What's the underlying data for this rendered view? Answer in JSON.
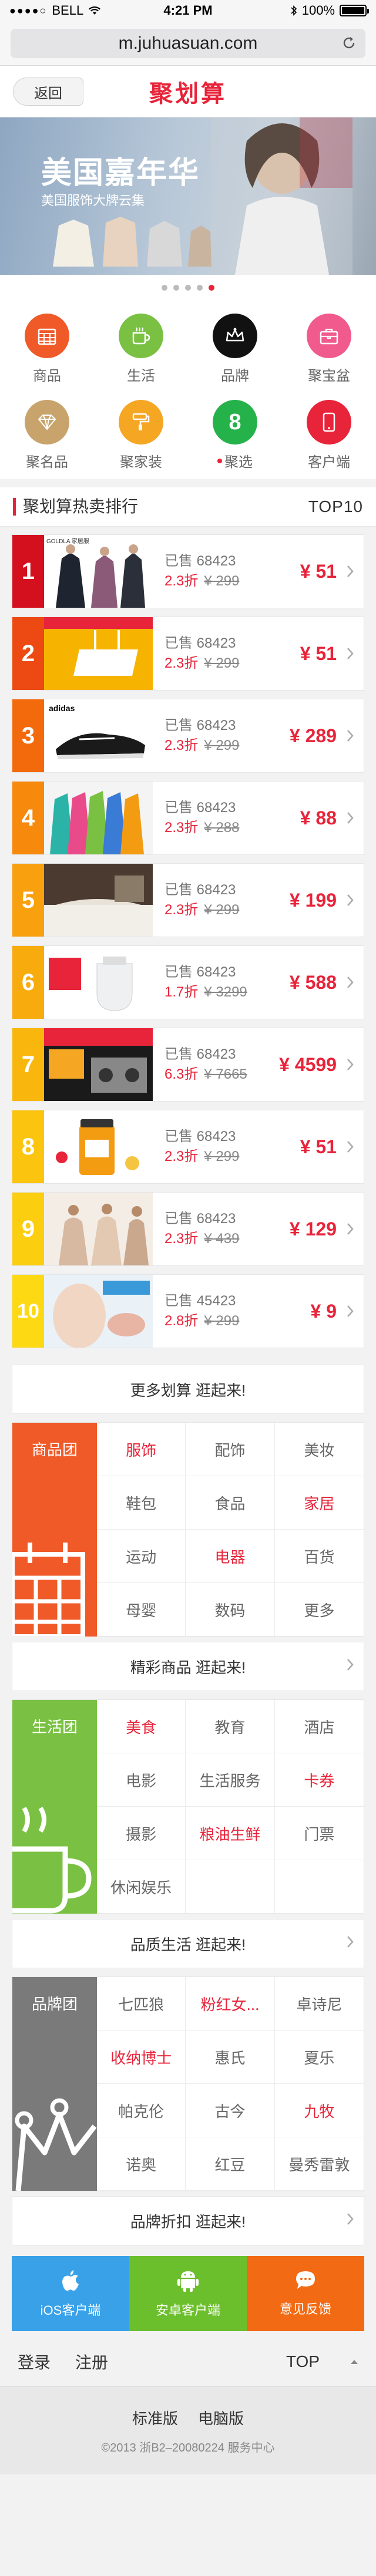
{
  "status_bar": {
    "carrier": "BELL",
    "time": "4:21 PM",
    "battery": "100%"
  },
  "address_bar": {
    "url": "m.juhuasuan.com"
  },
  "header": {
    "back_label": "返回",
    "title": "聚划算"
  },
  "banner": {
    "title": "美国嘉年华",
    "subtitle": "美国服饰大牌云集",
    "dots": 5,
    "active_dot": 5
  },
  "icon_grid": [
    {
      "label": "商品",
      "icon": "calendar-grid-icon",
      "color": "#f05a28"
    },
    {
      "label": "生活",
      "icon": "coffee-cup-icon",
      "color": "#7ac143"
    },
    {
      "label": "品牌",
      "icon": "crown-icon",
      "color": "#111111"
    },
    {
      "label": "聚宝盆",
      "icon": "briefcase-icon",
      "color": "#f05a8c"
    },
    {
      "label": "聚名品",
      "icon": "diamond-icon",
      "color": "#c8a46c"
    },
    {
      "label": "聚家装",
      "icon": "paint-roller-icon",
      "color": "#f5a623"
    },
    {
      "label": "聚选",
      "icon": "number-eight-icon",
      "color": "#26b24b",
      "glyph": "8"
    },
    {
      "label": "客户端",
      "icon": "phone-icon",
      "color": "#e8243a"
    }
  ],
  "ranking": {
    "title": "聚划算热卖排行",
    "right_label": "TOP10",
    "items": [
      {
        "rank": "1",
        "sold": "已售 68423",
        "discount": "2.3折",
        "original": "¥ 299",
        "price": "¥ 51",
        "color": "#d40f1e",
        "thumb_text": "GOLDLA 家居服"
      },
      {
        "rank": "2",
        "sold": "已售 68423",
        "discount": "2.3折",
        "original": "¥ 299",
        "price": "¥ 51",
        "color": "#ec4a12",
        "thumb_text": ""
      },
      {
        "rank": "3",
        "sold": "已售 68423",
        "discount": "2.3折",
        "original": "¥ 299",
        "price": "¥ 289",
        "color": "#f36a0c",
        "thumb_text": "adidas"
      },
      {
        "rank": "4",
        "sold": "已售 68423",
        "discount": "2.3折",
        "original": "¥ 288",
        "price": "¥ 88",
        "color": "#f7890d",
        "thumb_text": ""
      },
      {
        "rank": "5",
        "sold": "已售 68423",
        "discount": "2.3折",
        "original": "¥ 299",
        "price": "¥ 199",
        "color": "#f8a00d",
        "thumb_text": ""
      },
      {
        "rank": "6",
        "sold": "已售 68423",
        "discount": "1.7折",
        "original": "¥ 3299",
        "price": "¥ 588",
        "color": "#f8ab0c",
        "thumb_text": ""
      },
      {
        "rank": "7",
        "sold": "已售 68423",
        "discount": "6.3折",
        "original": "¥ 7665",
        "price": "¥ 4599",
        "color": "#f9b70d",
        "thumb_text": ""
      },
      {
        "rank": "8",
        "sold": "已售 68423",
        "discount": "2.3折",
        "original": "¥ 299",
        "price": "¥ 51",
        "color": "#fbc40e",
        "thumb_text": ""
      },
      {
        "rank": "9",
        "sold": "已售 68423",
        "discount": "2.3折",
        "original": "¥ 439",
        "price": "¥ 129",
        "color": "#fcce10",
        "thumb_text": ""
      },
      {
        "rank": "10",
        "sold": "已售 45423",
        "discount": "2.8折",
        "original": "¥ 299",
        "price": "¥ 9",
        "color": "#fdd913",
        "thumb_text": ""
      }
    ],
    "more_label": "更多划算  逛起来!"
  },
  "goods_group": {
    "name": "商品团",
    "color": "#f05a28",
    "cells": [
      {
        "label": "服饰",
        "hot": true
      },
      {
        "label": "配饰",
        "hot": false
      },
      {
        "label": "美妆",
        "hot": false
      },
      {
        "label": "鞋包",
        "hot": false
      },
      {
        "label": "食品",
        "hot": false
      },
      {
        "label": "家居",
        "hot": true
      },
      {
        "label": "运动",
        "hot": false
      },
      {
        "label": "电器",
        "hot": true
      },
      {
        "label": "百货",
        "hot": false
      },
      {
        "label": "母婴",
        "hot": false
      },
      {
        "label": "数码",
        "hot": false
      },
      {
        "label": "更多",
        "hot": false
      }
    ],
    "more_label": "精彩商品  逛起来!"
  },
  "life_group": {
    "name": "生活团",
    "color": "#7ac143",
    "cells": [
      {
        "label": "美食",
        "hot": true
      },
      {
        "label": "教育",
        "hot": false
      },
      {
        "label": "酒店",
        "hot": false
      },
      {
        "label": "电影",
        "hot": false
      },
      {
        "label": "生活服务",
        "hot": false
      },
      {
        "label": "卡券",
        "hot": true
      },
      {
        "label": "摄影",
        "hot": false
      },
      {
        "label": "粮油生鲜",
        "hot": true
      },
      {
        "label": "门票",
        "hot": false
      },
      {
        "label": "休闲娱乐",
        "hot": false
      },
      {
        "label": "",
        "hot": false
      },
      {
        "label": "",
        "hot": false
      }
    ],
    "more_label": "品质生活  逛起来!"
  },
  "brand_group": {
    "name": "品牌团",
    "color": "#7a7a7a",
    "cells": [
      {
        "label": "七匹狼",
        "hot": false
      },
      {
        "label": "粉红女...",
        "hot": true
      },
      {
        "label": "卓诗尼",
        "hot": false
      },
      {
        "label": "收纳博士",
        "hot": true
      },
      {
        "label": "惠氏",
        "hot": false
      },
      {
        "label": "夏乐",
        "hot": false
      },
      {
        "label": "帕克伦",
        "hot": false
      },
      {
        "label": "古今",
        "hot": false
      },
      {
        "label": "九牧",
        "hot": true
      },
      {
        "label": "诺奥",
        "hot": false
      },
      {
        "label": "红豆",
        "hot": false
      },
      {
        "label": "曼秀雷敦",
        "hot": false
      }
    ],
    "more_label": "品牌折扣  逛起来!"
  },
  "app_bar": [
    {
      "label": "iOS客户端",
      "icon": "apple-icon",
      "color": "#38a1e8"
    },
    {
      "label": "安卓客户端",
      "icon": "android-icon",
      "color": "#6cbf2c"
    },
    {
      "label": "意见反馈",
      "icon": "chat-bubble-icon",
      "color": "#f26a13"
    }
  ],
  "footer": {
    "login": "登录",
    "register": "注册",
    "top": "TOP",
    "standard": "标准版",
    "desktop": "电脑版",
    "copyright": "©2013 浙B2–20080224   服务中心"
  }
}
